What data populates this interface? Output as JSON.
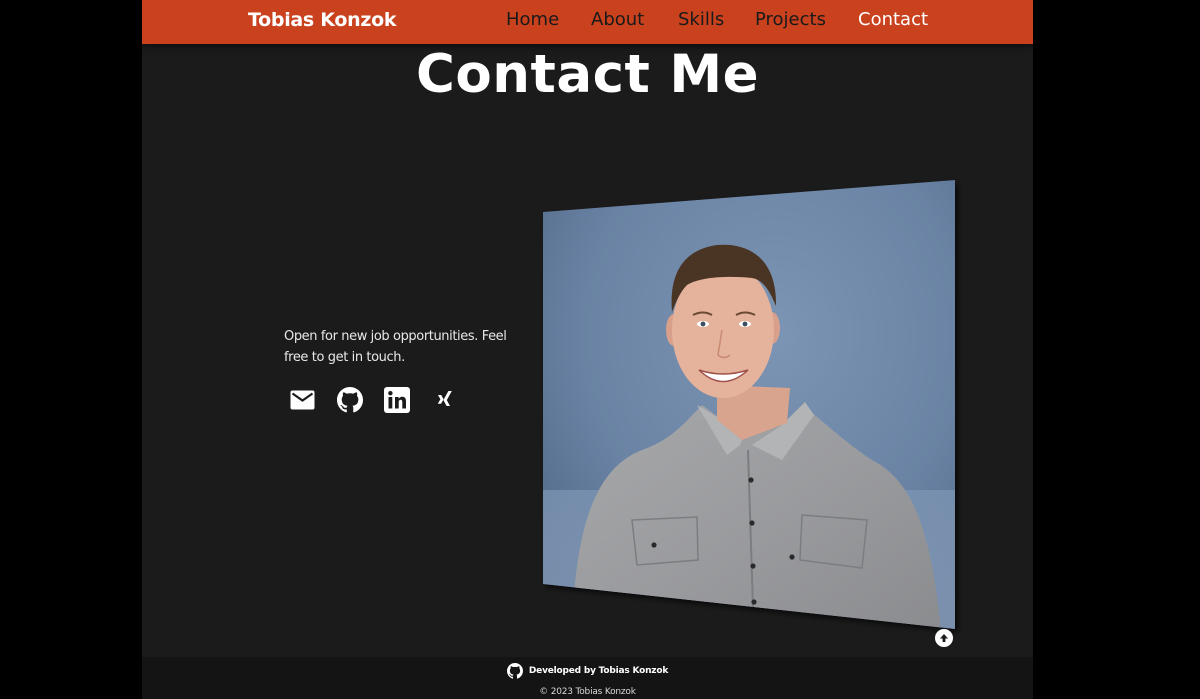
{
  "nav": {
    "brand": "Tobias Konzok",
    "links": [
      "Home",
      "About",
      "Skills",
      "Projects",
      "Contact"
    ],
    "active": "Contact"
  },
  "main": {
    "title": "Contact Me",
    "text": "Open for new job opportunities. Feel free to get in touch.",
    "social_icons": [
      "mail-icon",
      "github-icon",
      "linkedin-icon",
      "xing-icon"
    ]
  },
  "footer": {
    "developed": "Developed by Tobias Konzok",
    "copyright": "© 2023 Tobias Konzok"
  },
  "colors": {
    "accent": "#c9411d",
    "background": "#1b1b1b",
    "footer": "#141414",
    "outer": "#000000"
  }
}
